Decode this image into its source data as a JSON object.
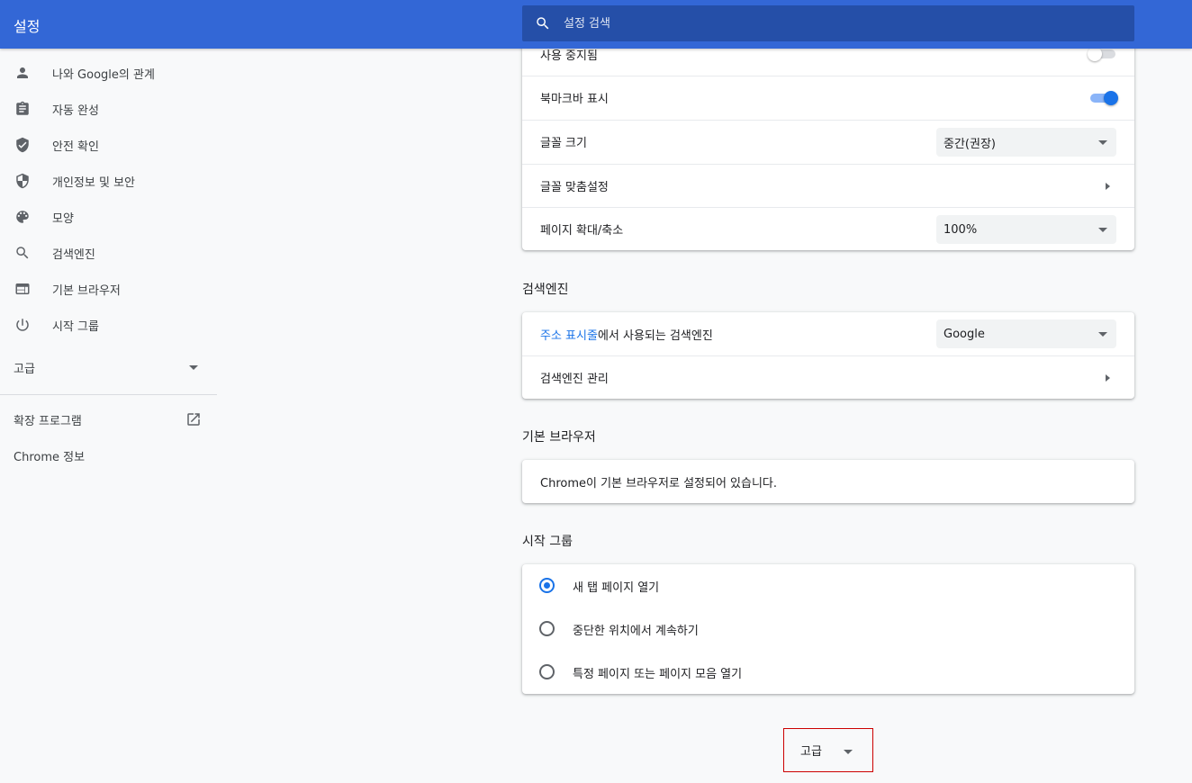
{
  "header": {
    "title": "설정",
    "search_placeholder": "설정 검색"
  },
  "sidebar": {
    "items": [
      {
        "label": "나와 Google의 관계",
        "icon": "person-icon"
      },
      {
        "label": "자동 완성",
        "icon": "clipboard-icon"
      },
      {
        "label": "안전 확인",
        "icon": "shield-check-icon"
      },
      {
        "label": "개인정보 및 보안",
        "icon": "shield-half-icon"
      },
      {
        "label": "모양",
        "icon": "palette-icon"
      },
      {
        "label": "검색엔진",
        "icon": "search-icon"
      },
      {
        "label": "기본 브라우저",
        "icon": "browser-icon"
      },
      {
        "label": "시작 그룹",
        "icon": "power-icon"
      }
    ],
    "advanced_label": "고급",
    "extensions_label": "확장 프로그램",
    "about_label": "Chrome 정보"
  },
  "appearance": {
    "partial_row_label": "사용 중지됨",
    "partial_toggle_on": false,
    "bookmarks_bar_label": "북마크바 표시",
    "bookmarks_bar_on": true,
    "font_size_label": "글꼴 크기",
    "font_size_value": "중간(권장)",
    "customize_fonts_label": "글꼴 맞춤설정",
    "page_zoom_label": "페이지 확대/축소",
    "page_zoom_value": "100%"
  },
  "search_engine": {
    "title": "검색엔진",
    "row_link": "주소 표시줄",
    "row_rest": "에서 사용되는 검색엔진",
    "value": "Google",
    "manage_label": "검색엔진 관리"
  },
  "default_browser": {
    "title": "기본 브라우저",
    "status": "Chrome이 기본 브라우저로 설정되어 있습니다."
  },
  "on_startup": {
    "title": "시작 그룹",
    "options": [
      {
        "label": "새 탭 페이지 열기",
        "selected": true
      },
      {
        "label": "중단한 위치에서 계속하기",
        "selected": false
      },
      {
        "label": "특정 페이지 또는 페이지 모음 열기",
        "selected": false
      }
    ]
  },
  "advanced_button": {
    "label": "고급"
  },
  "colors": {
    "header_bg": "#3367d6",
    "accent": "#1a73e8",
    "highlight_border": "#cc0000"
  }
}
